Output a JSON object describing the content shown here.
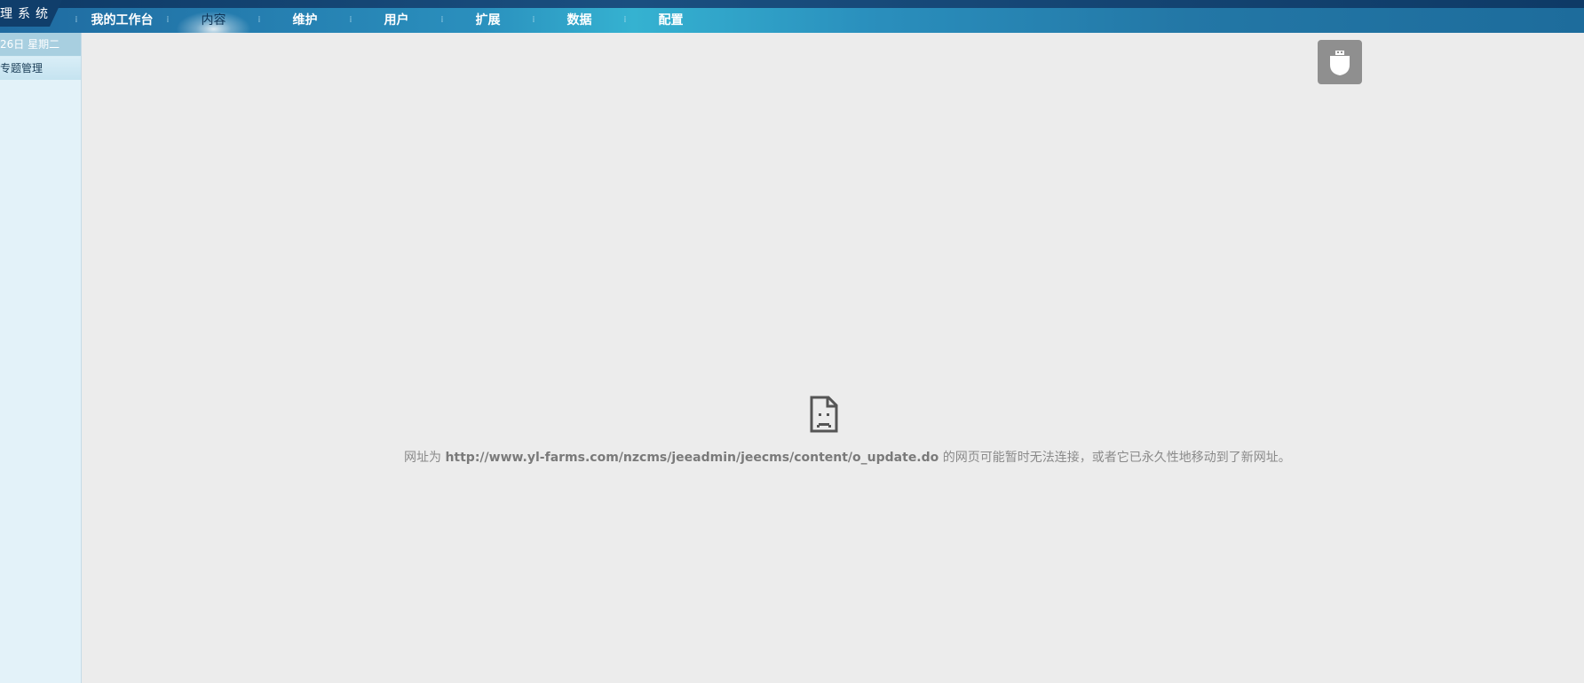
{
  "header": {
    "logo_text": "理系统",
    "nav": [
      {
        "label": "我的工作台",
        "active": false
      },
      {
        "label": "内容",
        "active": true
      },
      {
        "label": "维护",
        "active": false
      },
      {
        "label": "用户",
        "active": false
      },
      {
        "label": "扩展",
        "active": false
      },
      {
        "label": "数据",
        "active": false
      },
      {
        "label": "配置",
        "active": false
      }
    ]
  },
  "sidebar": {
    "date": "26日 星期二",
    "items": [
      {
        "label": "专题管理"
      }
    ]
  },
  "extension_button": {
    "icon": "shield-icon"
  },
  "error_page": {
    "icon": "sad-document-icon",
    "prefix": "网址为",
    "url": "http://www.yl-farms.com/nzcms/jeeadmin/jeecms/content/o_update.do",
    "suffix": "的网页可能暂时无法连接，或者它已永久性地移动到了新网址。"
  },
  "colors": {
    "nav_active_text": "#0f3557",
    "header_blue": "#2a8fbd",
    "page_background": "#ececec",
    "error_text": "#8a8a8a"
  }
}
